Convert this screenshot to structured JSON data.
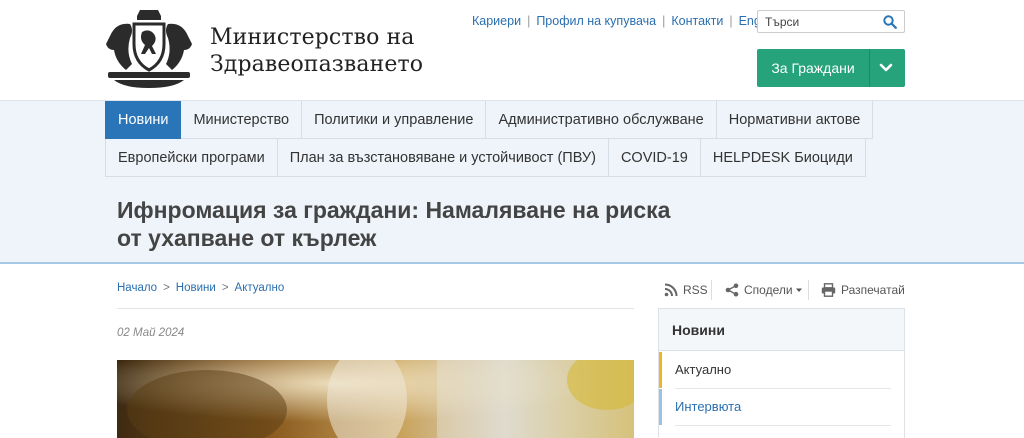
{
  "brand": {
    "line1": "Министерство на",
    "line2": "Здравеопазването"
  },
  "toplinks": [
    "Кариери",
    "Профил на купувача",
    "Контакти",
    "English"
  ],
  "search": {
    "placeholder": "Търси"
  },
  "citizens_button": {
    "label": "За Граждани"
  },
  "nav": {
    "row1": [
      "Новини",
      "Министерство",
      "Политики и управление",
      "Административно обслужване",
      "Нормативни актове"
    ],
    "row2": [
      "Европейски програми",
      "План за възстановяване и устойчивост (ПВУ)",
      "COVID-19",
      "HELPDESK Биоциди"
    ],
    "active": "Новини"
  },
  "page_title": "Ифнромация за граждани: Намаляване на риска от ухапване от кърлеж",
  "breadcrumb": [
    "Начало",
    "Новини",
    "Актуално"
  ],
  "breadcrumb_separator": ">",
  "date": "02 Май 2024",
  "tools": {
    "rss": "RSS",
    "share": "Сподели",
    "print": "Разпечатай"
  },
  "sidebar": {
    "title": "Новини",
    "items": [
      "Актуално",
      "Интервюта"
    ]
  },
  "colors": {
    "accent_blue": "#2a75b8",
    "citizens_green": "#26a37a",
    "active_marker": "#f0b429"
  }
}
